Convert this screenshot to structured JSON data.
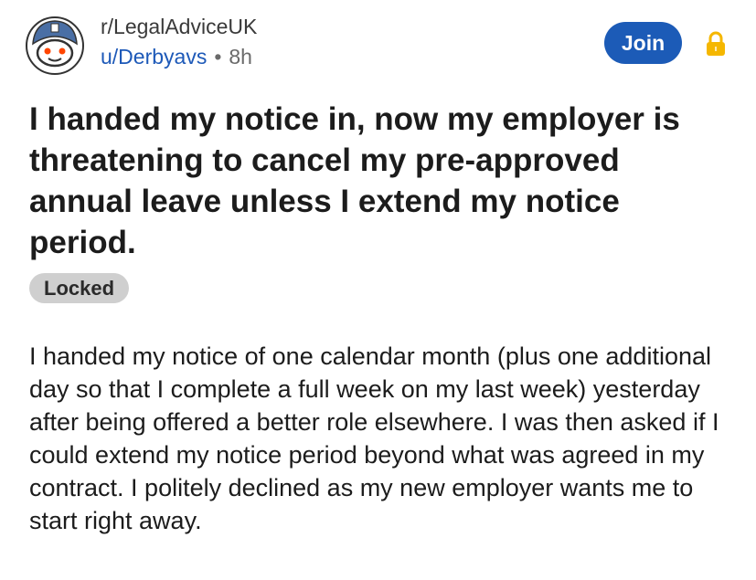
{
  "post": {
    "subreddit": "r/LegalAdviceUK",
    "author": "u/Derbyavs",
    "separator": "•",
    "age": "8h",
    "join_label": "Join",
    "title": "I handed my notice in, now my employer is threatening to cancel my pre-approved annual leave unless I extend my notice period.",
    "flair": "Locked",
    "body": "I handed my notice of one calendar month (plus one additional day so that I complete a full week on my last week) yesterday after being offered a better role elsewhere. I was then asked if I could extend my notice period beyond what was agreed in my contract. I politely declined as my new employer wants me to start right away."
  },
  "icons": {
    "avatar": "snoo-avatar-icon",
    "lock": "lock-icon"
  },
  "colors": {
    "join_button": "#1c5bb7",
    "username": "#1d59b8",
    "lock": "#f5b700",
    "flair_bg": "#cfcfcf"
  }
}
